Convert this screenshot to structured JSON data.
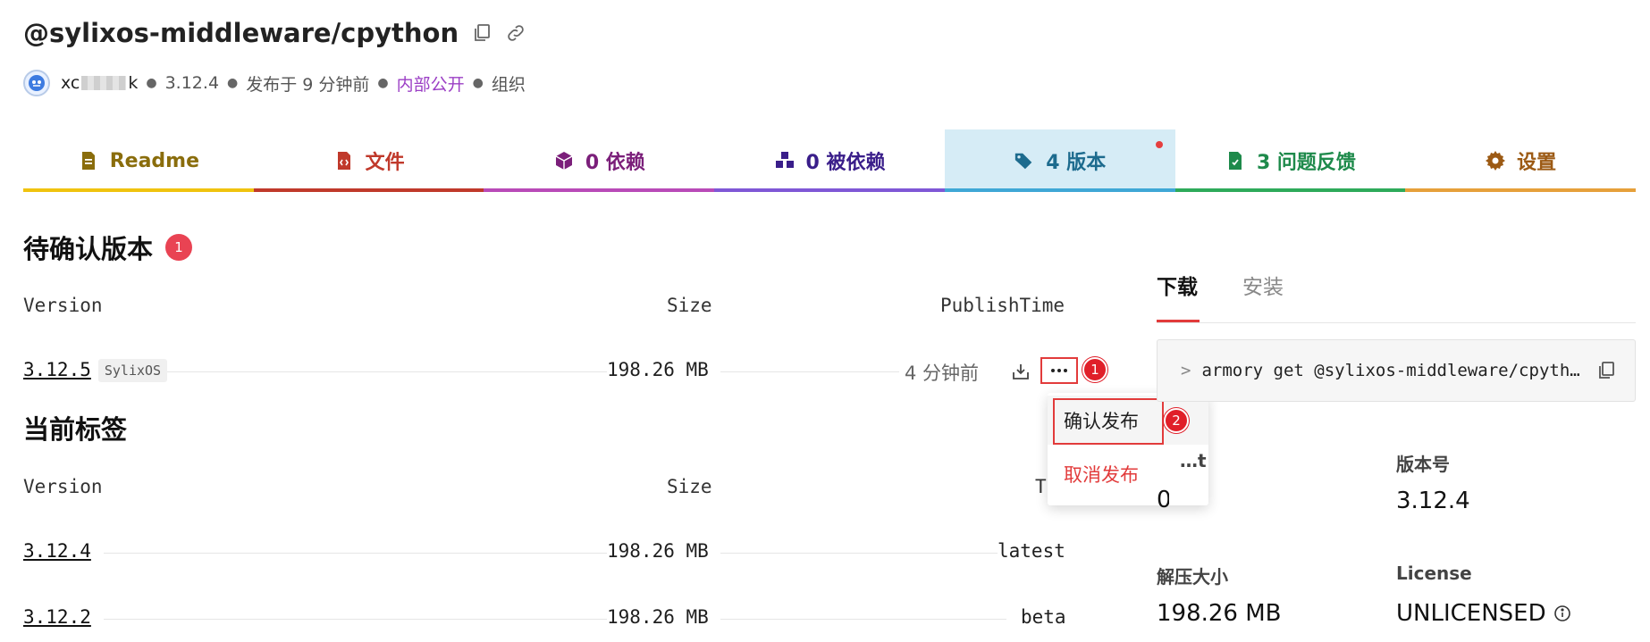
{
  "package": {
    "name": "@sylixos-middleware/cpython",
    "user_prefix": "xc",
    "user_suffix": "k",
    "version": "3.12.4",
    "published": "发布于 9 分钟前",
    "visibility": "内部公开",
    "scope": "组织"
  },
  "tabs": [
    {
      "label": "Readme",
      "icon": "file-text-icon",
      "color": "#8a6d0c",
      "underline": "#f0c30f"
    },
    {
      "label": "文件",
      "icon": "file-code-icon",
      "color": "#c0392b",
      "underline": "#c0392b"
    },
    {
      "label": "0 依赖",
      "icon": "cube-icon",
      "color": "#7b1f7a",
      "underline": "#b94ab8"
    },
    {
      "label": "0 被依赖",
      "icon": "cubes-icon",
      "color": "#3a1e8a",
      "underline": "#7f57d6"
    },
    {
      "label": "4 版本",
      "icon": "tags-icon",
      "color": "#1d6b8e",
      "underline": "#3fa7d6"
    },
    {
      "label": "3 问题反馈",
      "icon": "file-check-icon",
      "color": "#1e8a4b",
      "underline": "#2eaa5a"
    },
    {
      "label": "设置",
      "icon": "gear-icon",
      "color": "#9c5a14",
      "underline": "#e6a03a"
    }
  ],
  "pending": {
    "title": "待确认版本",
    "count": "1",
    "headers": {
      "version": "Version",
      "size": "Size",
      "time": "PublishTime"
    },
    "rows": [
      {
        "version": "3.12.5",
        "os": "SylixOS",
        "size": "198.26 MB",
        "time": "4 分钟前"
      }
    ],
    "step1": "1"
  },
  "menu": {
    "confirm": "确认发布",
    "cancel": "取消发布",
    "step2": "2"
  },
  "current": {
    "title": "当前标签",
    "headers": {
      "version": "Version",
      "size": "Size",
      "tag": "Ta"
    },
    "rows": [
      {
        "version": "3.12.4",
        "size": "198.26 MB",
        "tag": "latest"
      },
      {
        "version": "3.12.2",
        "size": "198.26 MB",
        "tag": "beta"
      }
    ]
  },
  "side": {
    "tabs": [
      "下载",
      "安装"
    ],
    "command": "armory get @sylixos-middleware/cpyth…",
    "prompt": ">",
    "info": [
      {
        "label": "…t",
        "value": "0"
      },
      {
        "label": "版本号",
        "value": "3.12.4"
      },
      {
        "label": "解压大小",
        "value": "198.26 MB"
      },
      {
        "label": "License",
        "value": "UNLICENSED"
      }
    ]
  }
}
